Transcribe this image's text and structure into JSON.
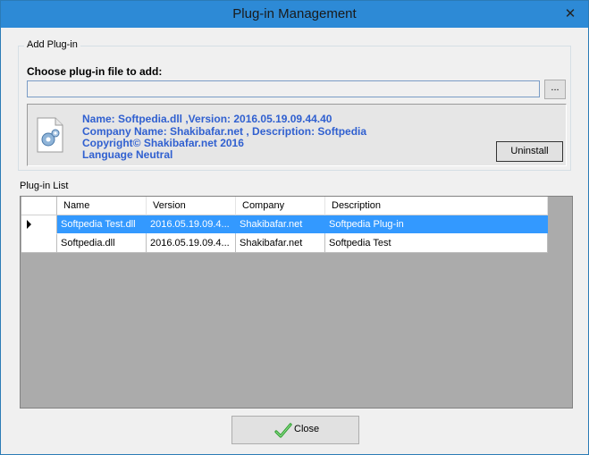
{
  "window": {
    "title": "Plug-in Management",
    "close_glyph": "✕"
  },
  "add_group": {
    "caption": "Add Plug-in",
    "choose_label": "Choose plug-in file to add:",
    "path_value": "",
    "browse_label": "...",
    "info": {
      "line1": "Name: Softpedia.dll ,Version: 2016.05.19.09.44.40",
      "line2": "Company Name: Shakibafar.net , Description: Softpedia",
      "line3": "Copyright© Shakibafar.net 2016",
      "line4": "Language Neutral",
      "icon": "dll-file-gear-icon"
    },
    "uninstall_label": "Uninstall"
  },
  "list_group": {
    "caption": "Plug-in List",
    "columns": [
      "Name",
      "Version",
      "Company",
      "Description"
    ],
    "rows": [
      {
        "name": "Softpedia Test.dll",
        "version": "2016.05.19.09.4...",
        "company": "Shakibafar.net",
        "description": "Softpedia Plug-in",
        "selected": true
      },
      {
        "name": "Softpedia.dll",
        "version": "2016.05.19.09.4...",
        "company": "Shakibafar.net",
        "description": "Softpedia Test",
        "selected": false
      }
    ]
  },
  "footer": {
    "close_label": "Close",
    "close_icon": "green-check-icon"
  },
  "colors": {
    "titlebar": "#2d8ad6",
    "selection": "#3399ff",
    "info_text": "#3060d0",
    "grid_bg": "#ababab"
  }
}
